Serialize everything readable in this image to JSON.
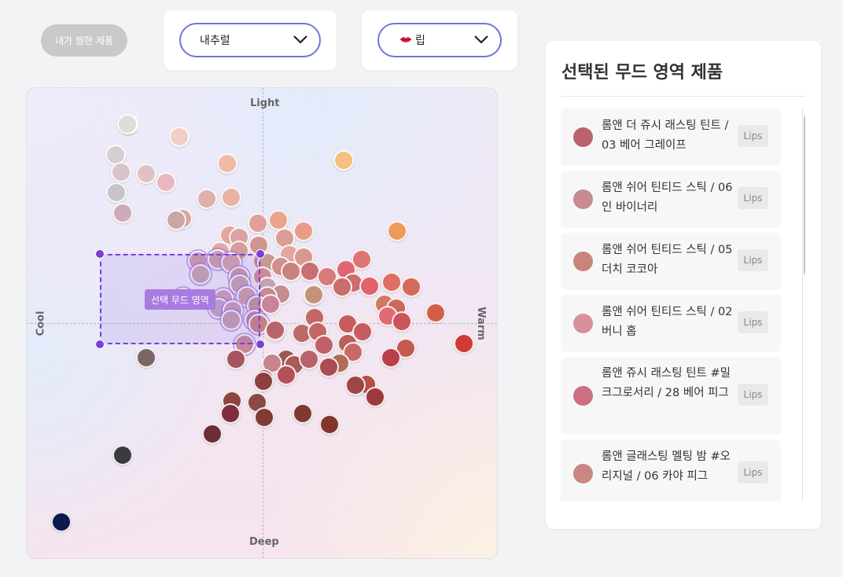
{
  "header": {
    "favorites_button": "내가 찜한 제품",
    "recommend_select": {
      "value": "내추럴"
    },
    "category_select": {
      "value": "립",
      "icon": "lips-icon"
    }
  },
  "plot": {
    "axis_labels": {
      "top": "Light",
      "bottom": "Deep",
      "left": "Cool",
      "right": "Warm"
    },
    "selection_label": "선택 무드 영역",
    "selection_color": "#7b3fd6"
  },
  "panel": {
    "title": "선택된 무드 영역 제품",
    "items": [
      {
        "name": "롬앤 더 쥬시 래스팅 틴트 / 03 베어 그레이프",
        "tag": "Lips",
        "color": "#b9646d"
      },
      {
        "name": "롬앤 쉬어 틴티드 스틱 / 06 인 바이너리",
        "tag": "Lips",
        "color": "#c98a92"
      },
      {
        "name": "롬앤 쉬어 틴티드 스틱 / 05 더치 코코아",
        "tag": "Lips",
        "color": "#c9857c"
      },
      {
        "name": "롬앤 쉬어 틴티드 스틱 / 02 버니 홉",
        "tag": "Lips",
        "color": "#d8919a"
      },
      {
        "name": "롬앤 쥬시 래스팅 틴트 #밀크그로서리 / 28 베어 피그",
        "tag": "Lips",
        "color": "#cc6f82"
      },
      {
        "name": "롬앤 글래스팅 멜팅 밤 #오리지널 / 06 카야 피그",
        "tag": "Lips",
        "color": "#c98784"
      }
    ]
  }
}
